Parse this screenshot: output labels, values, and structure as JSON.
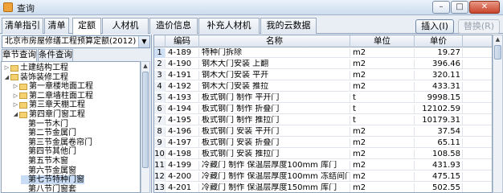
{
  "window": {
    "title": "查询",
    "min_glyph": "–",
    "max_glyph": "□",
    "close_glyph": "✕",
    "icon": "app-icon"
  },
  "tabs": [
    "清单指引",
    "清单",
    "定额",
    "人材机",
    "造价信息",
    "补充人材机",
    "我的云数据"
  ],
  "active_tab": "定额",
  "buttons": {
    "insert": "插入(I)",
    "replace": "替换(R)"
  },
  "quota_library": {
    "selected": "北京市房屋修缮工程预算定额(2012)",
    "arrow": "▼"
  },
  "subtabs": [
    "章节查询",
    "条件查询"
  ],
  "active_subtab": "章节查询",
  "tree": [
    {
      "label": "土建结构工程",
      "level": 0,
      "expander": "▷",
      "folder": true,
      "selected": false
    },
    {
      "label": "装饰装修工程",
      "level": 0,
      "expander": "◢",
      "folder": true,
      "selected": false
    },
    {
      "label": "第一章楼地面工程",
      "level": 1,
      "expander": "▷",
      "folder": true,
      "selected": false
    },
    {
      "label": "第二章墙柱面工程",
      "level": 1,
      "expander": "▷",
      "folder": true,
      "selected": false
    },
    {
      "label": "第三章天棚工程",
      "level": 1,
      "expander": "▷",
      "folder": true,
      "selected": false
    },
    {
      "label": "第四章门窗工程",
      "level": 1,
      "expander": "◢",
      "folder": true,
      "selected": false
    },
    {
      "label": "第一节木门",
      "level": 2,
      "expander": "",
      "folder": false,
      "selected": false
    },
    {
      "label": "第二节金属门",
      "level": 2,
      "expander": "",
      "folder": false,
      "selected": false
    },
    {
      "label": "第三节金属卷帘门",
      "level": 2,
      "expander": "",
      "folder": false,
      "selected": false
    },
    {
      "label": "第四节其他门",
      "level": 2,
      "expander": "",
      "folder": false,
      "selected": false
    },
    {
      "label": "第五节木窗",
      "level": 2,
      "expander": "",
      "folder": false,
      "selected": false
    },
    {
      "label": "第六节金属窗",
      "level": 2,
      "expander": "",
      "folder": false,
      "selected": false
    },
    {
      "label": "第七节特种门窗",
      "level": 2,
      "expander": "",
      "folder": false,
      "selected": true
    },
    {
      "label": "第八节门窗套",
      "level": 2,
      "expander": "",
      "folder": false,
      "selected": false
    }
  ],
  "grid": {
    "columns": {
      "code": "编码",
      "name": "名称",
      "unit": "单位",
      "price": "单价"
    },
    "rows": [
      {
        "n": "1",
        "code": "4-189",
        "name": "特种门拆除",
        "unit": "m2",
        "price": "19.27"
      },
      {
        "n": "2",
        "code": "4-190",
        "name": "钢木大门安装 上翻",
        "unit": "m2",
        "price": "396.46"
      },
      {
        "n": "3",
        "code": "4-191",
        "name": "钢木大门安装 平开",
        "unit": "m2",
        "price": "320.11"
      },
      {
        "n": "4",
        "code": "4-192",
        "name": "钢木大门安装 推拉",
        "unit": "m2",
        "price": "433.31"
      },
      {
        "n": "5",
        "code": "4-193",
        "name": "板式钢门 制作 平开门",
        "unit": "t",
        "price": "9998.15"
      },
      {
        "n": "6",
        "code": "4-194",
        "name": "板式钢门 制作 折叠门",
        "unit": "t",
        "price": "12102.59"
      },
      {
        "n": "7",
        "code": "4-195",
        "name": "板式钢门 制作 推拉门",
        "unit": "t",
        "price": "10179.31"
      },
      {
        "n": "8",
        "code": "4-196",
        "name": "板式钢门 安装 平开门",
        "unit": "m2",
        "price": "37.54"
      },
      {
        "n": "9",
        "code": "4-197",
        "name": "板式钢门 安装 折叠门",
        "unit": "m2",
        "price": "65.11"
      },
      {
        "n": "10",
        "code": "4-198",
        "name": "板式钢门 安装 推拉门",
        "unit": "m2",
        "price": "108.58"
      },
      {
        "n": "11",
        "code": "4-199",
        "name": "冷藏门 制作 保温层厚度100mm 库门",
        "unit": "m2",
        "price": "431.93"
      },
      {
        "n": "12",
        "code": "4-200",
        "name": "冷藏门 制作 保温层厚度100mm 冻结间门",
        "unit": "m2",
        "price": "475.15"
      },
      {
        "n": "13",
        "code": "4-201",
        "name": "冷藏门 制作 保温层厚度150mm 库门",
        "unit": "m2",
        "price": "502.55"
      }
    ]
  },
  "scroll_glyph": "▲"
}
